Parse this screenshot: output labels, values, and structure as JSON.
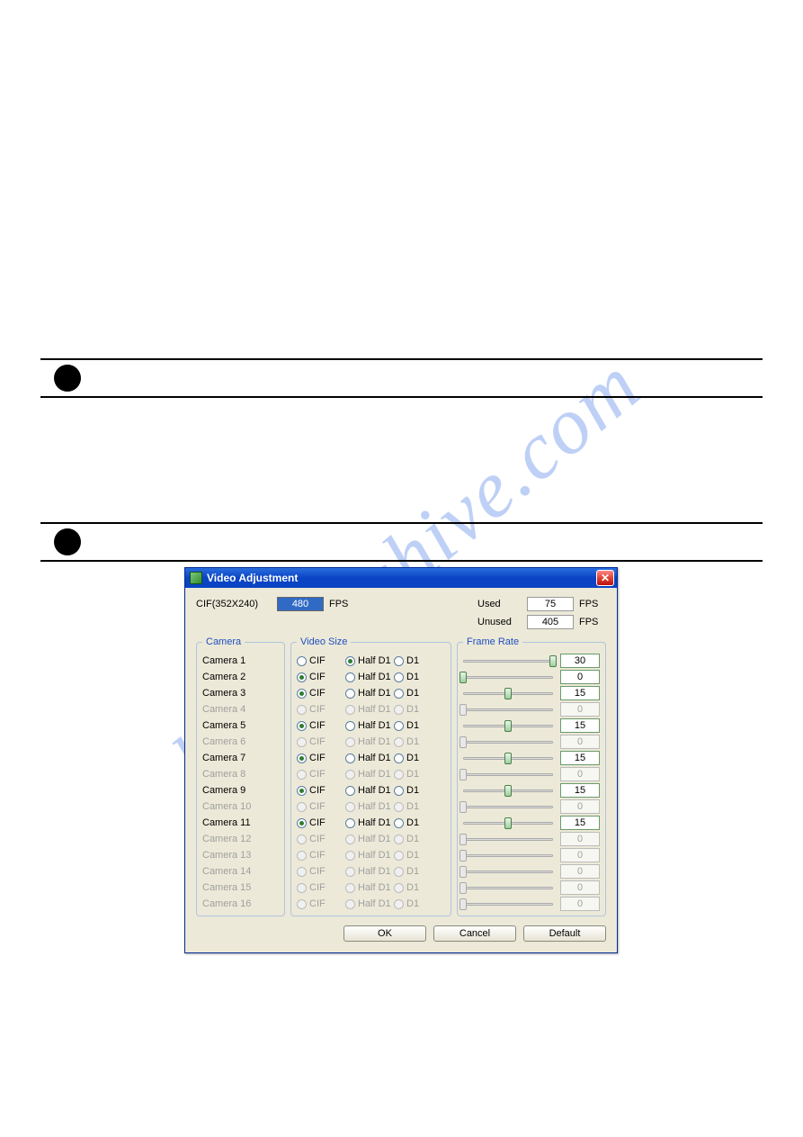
{
  "watermark": "manualshive.com",
  "dialog": {
    "title": "Video Adjustment",
    "close_glyph": "✕",
    "cif_label": "CIF(352X240)",
    "cif_value": "480",
    "fps_unit": "FPS",
    "used_label": "Used",
    "used_value": "75",
    "unused_label": "Unused",
    "unused_value": "405",
    "group_camera": "Camera",
    "group_size": "Video Size",
    "group_frame": "Frame Rate",
    "size_options": [
      "CIF",
      "Half D1",
      "D1"
    ],
    "buttons": {
      "ok": "OK",
      "cancel": "Cancel",
      "default": "Default"
    },
    "slider_max": 30,
    "cameras": [
      {
        "name": "Camera 1",
        "enabled": true,
        "size": "Half D1",
        "fps": 30
      },
      {
        "name": "Camera 2",
        "enabled": true,
        "size": "CIF",
        "fps": 0
      },
      {
        "name": "Camera 3",
        "enabled": true,
        "size": "CIF",
        "fps": 15
      },
      {
        "name": "Camera 4",
        "enabled": false,
        "size": "CIF",
        "fps": 0
      },
      {
        "name": "Camera 5",
        "enabled": true,
        "size": "CIF",
        "fps": 15
      },
      {
        "name": "Camera 6",
        "enabled": false,
        "size": "CIF",
        "fps": 0
      },
      {
        "name": "Camera 7",
        "enabled": true,
        "size": "CIF",
        "fps": 15
      },
      {
        "name": "Camera 8",
        "enabled": false,
        "size": "CIF",
        "fps": 0
      },
      {
        "name": "Camera 9",
        "enabled": true,
        "size": "CIF",
        "fps": 15
      },
      {
        "name": "Camera 10",
        "enabled": false,
        "size": "CIF",
        "fps": 0
      },
      {
        "name": "Camera 11",
        "enabled": true,
        "size": "CIF",
        "fps": 15
      },
      {
        "name": "Camera 12",
        "enabled": false,
        "size": "CIF",
        "fps": 0
      },
      {
        "name": "Camera 13",
        "enabled": false,
        "size": "CIF",
        "fps": 0
      },
      {
        "name": "Camera 14",
        "enabled": false,
        "size": "CIF",
        "fps": 0
      },
      {
        "name": "Camera 15",
        "enabled": false,
        "size": "CIF",
        "fps": 0
      },
      {
        "name": "Camera 16",
        "enabled": false,
        "size": "CIF",
        "fps": 0
      }
    ]
  }
}
